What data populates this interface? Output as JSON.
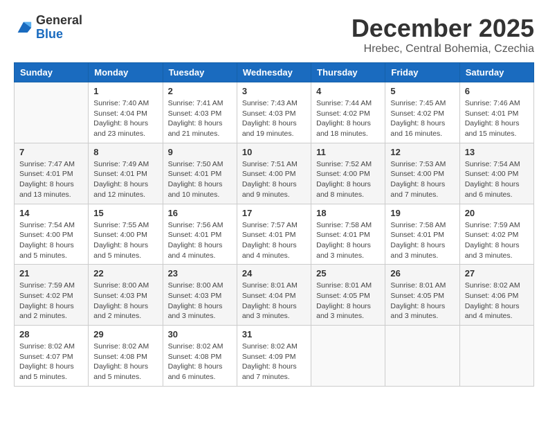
{
  "logo": {
    "general": "General",
    "blue": "Blue"
  },
  "title": "December 2025",
  "subtitle": "Hrebec, Central Bohemia, Czechia",
  "days_of_week": [
    "Sunday",
    "Monday",
    "Tuesday",
    "Wednesday",
    "Thursday",
    "Friday",
    "Saturday"
  ],
  "weeks": [
    [
      {
        "day": "",
        "info": ""
      },
      {
        "day": "1",
        "info": "Sunrise: 7:40 AM\nSunset: 4:04 PM\nDaylight: 8 hours\nand 23 minutes."
      },
      {
        "day": "2",
        "info": "Sunrise: 7:41 AM\nSunset: 4:03 PM\nDaylight: 8 hours\nand 21 minutes."
      },
      {
        "day": "3",
        "info": "Sunrise: 7:43 AM\nSunset: 4:03 PM\nDaylight: 8 hours\nand 19 minutes."
      },
      {
        "day": "4",
        "info": "Sunrise: 7:44 AM\nSunset: 4:02 PM\nDaylight: 8 hours\nand 18 minutes."
      },
      {
        "day": "5",
        "info": "Sunrise: 7:45 AM\nSunset: 4:02 PM\nDaylight: 8 hours\nand 16 minutes."
      },
      {
        "day": "6",
        "info": "Sunrise: 7:46 AM\nSunset: 4:01 PM\nDaylight: 8 hours\nand 15 minutes."
      }
    ],
    [
      {
        "day": "7",
        "info": "Sunrise: 7:47 AM\nSunset: 4:01 PM\nDaylight: 8 hours\nand 13 minutes."
      },
      {
        "day": "8",
        "info": "Sunrise: 7:49 AM\nSunset: 4:01 PM\nDaylight: 8 hours\nand 12 minutes."
      },
      {
        "day": "9",
        "info": "Sunrise: 7:50 AM\nSunset: 4:01 PM\nDaylight: 8 hours\nand 10 minutes."
      },
      {
        "day": "10",
        "info": "Sunrise: 7:51 AM\nSunset: 4:00 PM\nDaylight: 8 hours\nand 9 minutes."
      },
      {
        "day": "11",
        "info": "Sunrise: 7:52 AM\nSunset: 4:00 PM\nDaylight: 8 hours\nand 8 minutes."
      },
      {
        "day": "12",
        "info": "Sunrise: 7:53 AM\nSunset: 4:00 PM\nDaylight: 8 hours\nand 7 minutes."
      },
      {
        "day": "13",
        "info": "Sunrise: 7:54 AM\nSunset: 4:00 PM\nDaylight: 8 hours\nand 6 minutes."
      }
    ],
    [
      {
        "day": "14",
        "info": "Sunrise: 7:54 AM\nSunset: 4:00 PM\nDaylight: 8 hours\nand 5 minutes."
      },
      {
        "day": "15",
        "info": "Sunrise: 7:55 AM\nSunset: 4:00 PM\nDaylight: 8 hours\nand 5 minutes."
      },
      {
        "day": "16",
        "info": "Sunrise: 7:56 AM\nSunset: 4:01 PM\nDaylight: 8 hours\nand 4 minutes."
      },
      {
        "day": "17",
        "info": "Sunrise: 7:57 AM\nSunset: 4:01 PM\nDaylight: 8 hours\nand 4 minutes."
      },
      {
        "day": "18",
        "info": "Sunrise: 7:58 AM\nSunset: 4:01 PM\nDaylight: 8 hours\nand 3 minutes."
      },
      {
        "day": "19",
        "info": "Sunrise: 7:58 AM\nSunset: 4:01 PM\nDaylight: 8 hours\nand 3 minutes."
      },
      {
        "day": "20",
        "info": "Sunrise: 7:59 AM\nSunset: 4:02 PM\nDaylight: 8 hours\nand 3 minutes."
      }
    ],
    [
      {
        "day": "21",
        "info": "Sunrise: 7:59 AM\nSunset: 4:02 PM\nDaylight: 8 hours\nand 2 minutes."
      },
      {
        "day": "22",
        "info": "Sunrise: 8:00 AM\nSunset: 4:03 PM\nDaylight: 8 hours\nand 2 minutes."
      },
      {
        "day": "23",
        "info": "Sunrise: 8:00 AM\nSunset: 4:03 PM\nDaylight: 8 hours\nand 3 minutes."
      },
      {
        "day": "24",
        "info": "Sunrise: 8:01 AM\nSunset: 4:04 PM\nDaylight: 8 hours\nand 3 minutes."
      },
      {
        "day": "25",
        "info": "Sunrise: 8:01 AM\nSunset: 4:05 PM\nDaylight: 8 hours\nand 3 minutes."
      },
      {
        "day": "26",
        "info": "Sunrise: 8:01 AM\nSunset: 4:05 PM\nDaylight: 8 hours\nand 3 minutes."
      },
      {
        "day": "27",
        "info": "Sunrise: 8:02 AM\nSunset: 4:06 PM\nDaylight: 8 hours\nand 4 minutes."
      }
    ],
    [
      {
        "day": "28",
        "info": "Sunrise: 8:02 AM\nSunset: 4:07 PM\nDaylight: 8 hours\nand 5 minutes."
      },
      {
        "day": "29",
        "info": "Sunrise: 8:02 AM\nSunset: 4:08 PM\nDaylight: 8 hours\nand 5 minutes."
      },
      {
        "day": "30",
        "info": "Sunrise: 8:02 AM\nSunset: 4:08 PM\nDaylight: 8 hours\nand 6 minutes."
      },
      {
        "day": "31",
        "info": "Sunrise: 8:02 AM\nSunset: 4:09 PM\nDaylight: 8 hours\nand 7 minutes."
      },
      {
        "day": "",
        "info": ""
      },
      {
        "day": "",
        "info": ""
      },
      {
        "day": "",
        "info": ""
      }
    ]
  ]
}
